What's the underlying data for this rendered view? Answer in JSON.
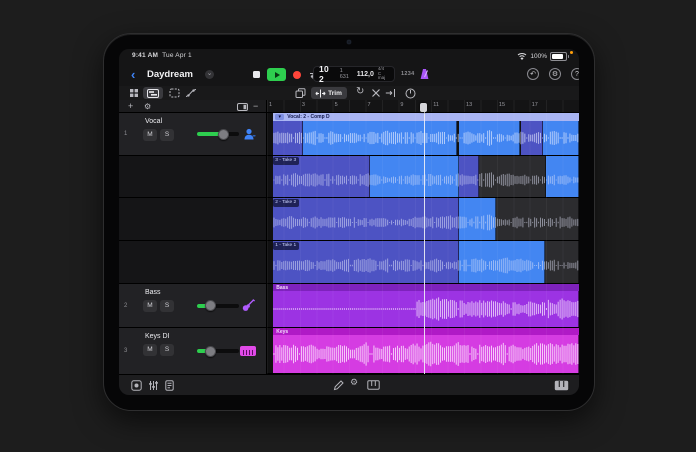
{
  "status": {
    "time": "9:41 AM",
    "date": "Tue Apr 1",
    "battery": "100%"
  },
  "titlebar": {
    "title": "Daydream"
  },
  "lcd": {
    "position_main": "10 2",
    "position_sub": "1 631",
    "tempo": "112,0",
    "time_signature": "4/4",
    "key": "C maj",
    "count_in": "1234"
  },
  "toolbar": {
    "trim_label": "Trim"
  },
  "controls": {
    "mute": "M",
    "solo": "S"
  },
  "ruler": {
    "labels": [
      "1",
      "3",
      "5",
      "7",
      "9",
      "11",
      "13",
      "15",
      "17"
    ]
  },
  "playhead": {
    "position_pct": 50.3
  },
  "tracks": [
    {
      "num": "1",
      "name": "Vocal",
      "icon": "vocalist",
      "fader_pct": 62,
      "lanes": [
        {
          "label": "Vocal: 2 - Comp D",
          "kind": "comp",
          "segments": [
            [
              2,
              9.5,
              "base"
            ],
            [
              11.5,
              49.5,
              "bright"
            ],
            [
              61.5,
              19.5,
              "bright"
            ],
            [
              81.5,
              7,
              "base"
            ],
            [
              88.5,
              11.5,
              "bright"
            ]
          ]
        },
        {
          "label": "3 - Take 3",
          "kind": "take",
          "segments": [
            [
              2,
              31,
              "base"
            ],
            [
              33,
              28.5,
              "bright"
            ],
            [
              61.5,
              6.5,
              "base"
            ],
            [
              68,
              21.5,
              "dim"
            ],
            [
              89.5,
              10.5,
              "bright"
            ]
          ]
        },
        {
          "label": "2 - Take 2",
          "kind": "take",
          "segments": [
            [
              2,
              59.5,
              "base"
            ],
            [
              61.5,
              12,
              "bright"
            ],
            [
              73.5,
              26.5,
              "dim"
            ]
          ]
        },
        {
          "label": "1 - Take 1",
          "kind": "take",
          "segments": [
            [
              2,
              59.5,
              "base"
            ],
            [
              61.5,
              27.5,
              "bright"
            ],
            [
              89,
              11,
              "dim"
            ]
          ]
        }
      ]
    },
    {
      "num": "2",
      "name": "Bass",
      "icon": "bass",
      "fader_pct": 33,
      "lanes": [
        {
          "label": "Bass",
          "kind": "purple",
          "segments": [
            [
              2,
              98,
              "purple"
            ]
          ]
        }
      ]
    },
    {
      "num": "3",
      "name": "Keys DI",
      "icon": "keys",
      "fader_pct": 33,
      "lanes": [
        {
          "label": "Keys",
          "kind": "magenta",
          "segments": [
            [
              2,
              98,
              "magenta"
            ]
          ]
        }
      ]
    }
  ],
  "colors": {
    "accent_blue": "#3f83f7",
    "play_green": "#2ece4f",
    "record_red": "#ff453a",
    "metronome_purple": "#a855f7",
    "region_bright_blue": "#4386f2",
    "region_indigo": "#4d53c3",
    "region_purple": "#9c33e3",
    "region_magenta": "#d53ce2"
  }
}
